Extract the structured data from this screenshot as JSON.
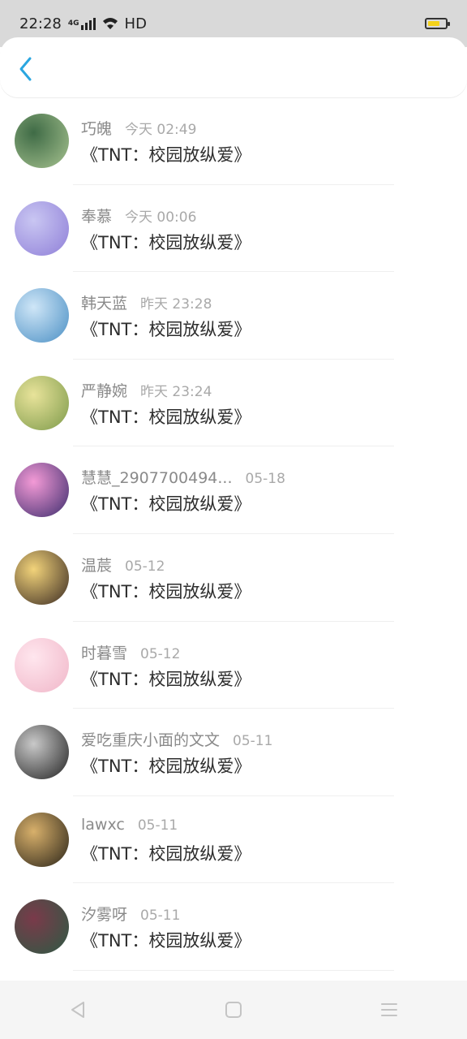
{
  "status_bar": {
    "time": "22:28",
    "network": "4G",
    "hd_label": "HD",
    "battery_level": 0.7,
    "battery_color": "#f5d21a"
  },
  "header": {
    "back_icon": "chevron-left-icon",
    "accent_color": "#2aa6e0"
  },
  "messages": [
    {
      "name": "巧魄",
      "time": "今天 02:49",
      "text": "《TNT：校园放纵爱》",
      "avatar_colors": [
        "#3f6b46",
        "#a6c28f"
      ]
    },
    {
      "name": "奉慕",
      "time": "今天 00:06",
      "text": "《TNT：校园放纵爱》",
      "avatar_colors": [
        "#c9c6f2",
        "#8f7fd8"
      ]
    },
    {
      "name": "韩天蓝",
      "time": "昨天 23:28",
      "text": "《TNT：校园放纵爱》",
      "avatar_colors": [
        "#cfe6f7",
        "#4a8fc4"
      ]
    },
    {
      "name": "严静婉",
      "time": "昨天 23:24",
      "text": "《TNT：校园放纵爱》",
      "avatar_colors": [
        "#e8e39a",
        "#7d9a4a"
      ]
    },
    {
      "name": "慧慧_2907700494...",
      "time": "05-18",
      "text": "《TNT：校园放纵爱》",
      "avatar_colors": [
        "#f39ad6",
        "#3c2c6d"
      ]
    },
    {
      "name": "温莀",
      "time": "05-12",
      "text": "《TNT：校园放纵爱》",
      "avatar_colors": [
        "#f2d37a",
        "#3a2a22"
      ]
    },
    {
      "name": "时暮雪",
      "time": "05-12",
      "text": "《TNT：校园放纵爱》",
      "avatar_colors": [
        "#ffe6ee",
        "#f0b6c8"
      ]
    },
    {
      "name": "爱吃重庆小面的文文",
      "time": "05-11",
      "text": "《TNT：校园放纵爱》",
      "avatar_colors": [
        "#c9c9c9",
        "#222222"
      ]
    },
    {
      "name": "lawxc",
      "time": "05-11",
      "text": "《TNT：校园放纵爱》",
      "avatar_colors": [
        "#d8b06b",
        "#2a2418"
      ]
    },
    {
      "name": "汐雾呀",
      "time": "05-11",
      "text": "《TNT：校园放纵爱》",
      "avatar_colors": [
        "#7a3a4a",
        "#2d5a44"
      ]
    }
  ],
  "nav_bar": {
    "back_icon": "triangle-back-icon",
    "home_icon": "square-home-icon",
    "menu_icon": "menu-lines-icon"
  }
}
